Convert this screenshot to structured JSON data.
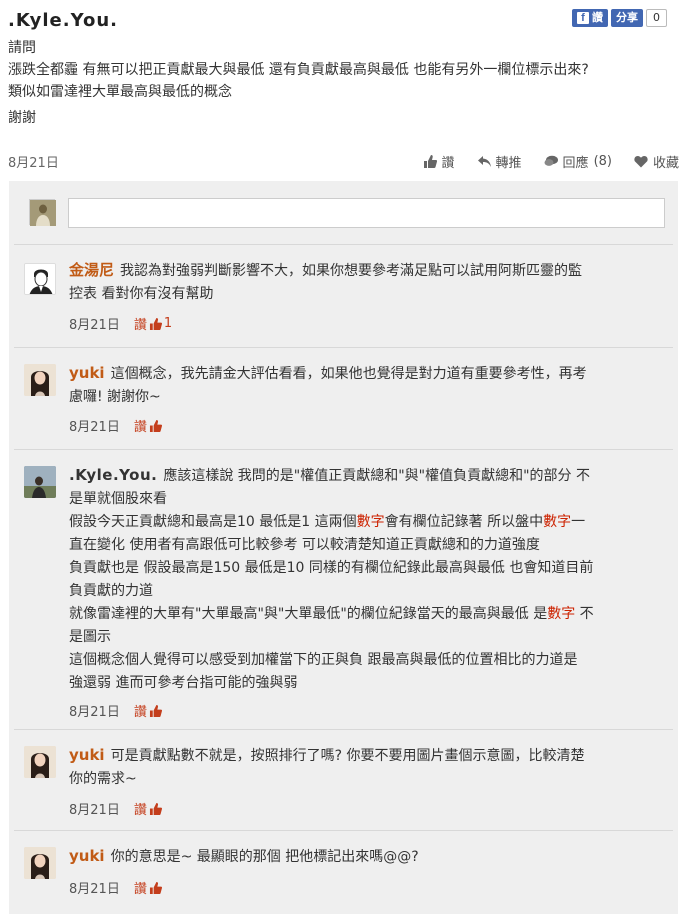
{
  "post": {
    "author": ".Kyle.You.",
    "fb_like_label": "讚",
    "fb_share_label": "分享",
    "fb_count": "0",
    "lines": [
      "請問",
      "漲跌全都霾 有無可以把正貢獻最大與最低 還有負貢獻最高與最低 也能有另外一欄位標示出來?",
      "類似如雷達裡大單最高與最低的概念",
      "謝謝"
    ],
    "date": "8月21日",
    "actions": {
      "like": "讚",
      "share": "轉推",
      "reply": "回應",
      "reply_count": "(8)",
      "bookmark": "收藏"
    }
  },
  "comments": [
    {
      "author": "金湯尼",
      "lines": [
        "我認為對強弱判斷影響不大，如果你想要參考滿足點可以試用阿斯匹靈的監",
        "控表 看對你有沒有幫助"
      ],
      "date": "8月21日",
      "like_label": "讚",
      "like_count": "1"
    },
    {
      "author": "yuki",
      "lines": [
        "這個概念，我先請金大評估看看，如果他也覺得是對力道有重要參考性，再考",
        "慮囉! 謝謝你~"
      ],
      "date": "8月21日",
      "like_label": "讚",
      "like_count": ""
    },
    {
      "author": ".Kyle.You.",
      "line1": "應該這樣說 我問的是\"權值正貢獻總和\"與\"權值負貢獻總和\"的部分 不",
      "line2": "是單就個股來看",
      "line3a": "假設今天正貢獻總和最高是10 最低是1 這兩個",
      "line3red": "數字",
      "line3b": "會有欄位記錄著 所以盤中",
      "line3red2": "數字",
      "line3c": "一",
      "line4": "直在變化 使用者有高跟低可比較參考 可以較清楚知道正貢獻總和的力道強度",
      "line5": "負貢獻也是 假設最高是150 最低是10 同樣的有欄位紀錄此最高與最低 也會知道目前",
      "line6": "負貢獻的力道",
      "line7a": "就像雷達裡的大單有\"大單最高\"與\"大單最低\"的欄位紀錄當天的最高與最低 是",
      "line7red": "數字",
      "line7b": " 不",
      "line8": "是圖示",
      "line9": "這個概念個人覺得可以感受到加權當下的正與負 跟最高與最低的位置相比的力道是",
      "line10": "強還弱 進而可參考台指可能的強與弱",
      "date": "8月21日",
      "like_label": "讚"
    },
    {
      "author": "yuki",
      "lines": [
        "可是貢獻點數不就是，按照排行了嗎? 你要不要用圖片畫個示意圖，比較清楚",
        "你的需求~"
      ],
      "date": "8月21日",
      "like_label": "讚"
    },
    {
      "author": "yuki",
      "lines": [
        "你的意思是~ 最顯眼的那個 把他標記出來嗎@@?"
      ],
      "date": "8月21日",
      "like_label": "讚"
    }
  ]
}
